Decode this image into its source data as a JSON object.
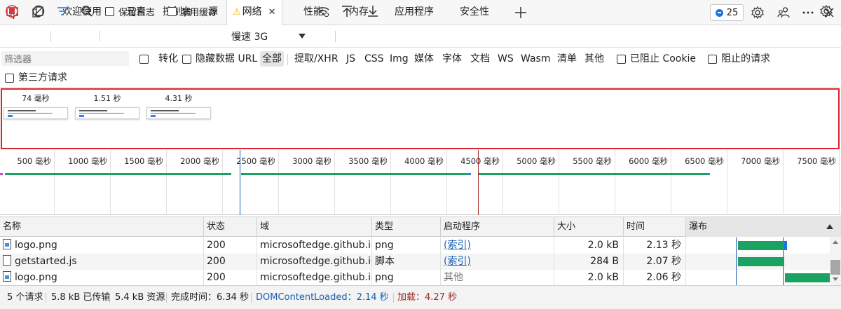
{
  "tabs": {
    "welcome": "欢迎使用",
    "elements": "元素",
    "console": "控制台",
    "sources": "源",
    "network": "网络",
    "performance": "性能",
    "memory": "内存",
    "application": "应用程序",
    "security": "安全性"
  },
  "issues_count": "25",
  "toolbar": {
    "preserve_log": "保留日志",
    "disable_cache": "禁用缓存",
    "throttling": "慢速 3G"
  },
  "filter": {
    "placeholder": "筛选器",
    "invert": "转化",
    "hide_data_urls": "隐藏数据 URL",
    "types": [
      "全部",
      "提取/XHR",
      "JS",
      "CSS",
      "Img",
      "媒体",
      "字体",
      "文档",
      "WS",
      "Wasm",
      "清单",
      "其他"
    ],
    "blocked_cookies": "已阻止 Cookie",
    "blocked_requests": "阻止的请求",
    "third_party": "第三方请求"
  },
  "filmstrip": {
    "frames": [
      "74 毫秒",
      "1.51 秒",
      "4.31 秒"
    ]
  },
  "overview": {
    "ticks": [
      "500 毫秒",
      "1000 毫秒",
      "1500 毫秒",
      "2000 毫秒",
      "2500 毫秒",
      "3000 毫秒",
      "3500 毫秒",
      "4000 毫秒",
      "4500 毫秒",
      "5000 毫秒",
      "5500 毫秒",
      "6000 毫秒",
      "6500 毫秒",
      "7000 毫秒",
      "7500 毫秒"
    ]
  },
  "table": {
    "headers": {
      "name": "名称",
      "status": "状态",
      "domain": "域",
      "type": "类型",
      "initiator": "启动程序",
      "size": "大小",
      "time": "时间",
      "waterfall": "瀑布"
    },
    "rows": [
      {
        "name": "logo.png",
        "status": "200",
        "domain": "microsoftedge.github.io",
        "type": "png",
        "initiator": "(索引)",
        "size": "2.0 kB",
        "time": "2.13 秒"
      },
      {
        "name": "getstarted.js",
        "status": "200",
        "domain": "microsoftedge.github.io",
        "type": "脚本",
        "initiator": "(索引)",
        "size": "284 B",
        "time": "2.07 秒"
      },
      {
        "name": "logo.png",
        "status": "200",
        "domain": "microsoftedge.github.io",
        "type": "png",
        "initiator": "其他",
        "size": "2.0 kB",
        "time": "2.06 秒"
      }
    ]
  },
  "status": {
    "requests": "5 个请求",
    "transferred": "5.8 kB 已传输",
    "resources": "5.4 kB 资源",
    "finish": "完成时间：6.34 秒",
    "dcl": "DOMContentLoaded：2.14 秒",
    "load": "加载：4.27 秒"
  },
  "colors": {
    "record": "#e0343a",
    "filmstrip_border": "#d9232d",
    "bar": "#1aa260",
    "dcl_line": "#1a5fb4",
    "load_line": "#a52a2a",
    "link": "#1a5fb4"
  },
  "icons": [
    "device-icon",
    "dock-icon",
    "warning-icon",
    "close-icon",
    "add-icon",
    "issues-icon",
    "settings-icon",
    "people-icon",
    "more-icon",
    "record-icon",
    "clear-icon",
    "filter-icon",
    "search-icon",
    "wifi-icon",
    "upload-icon",
    "download-icon",
    "file-icon",
    "image-file-icon"
  ]
}
